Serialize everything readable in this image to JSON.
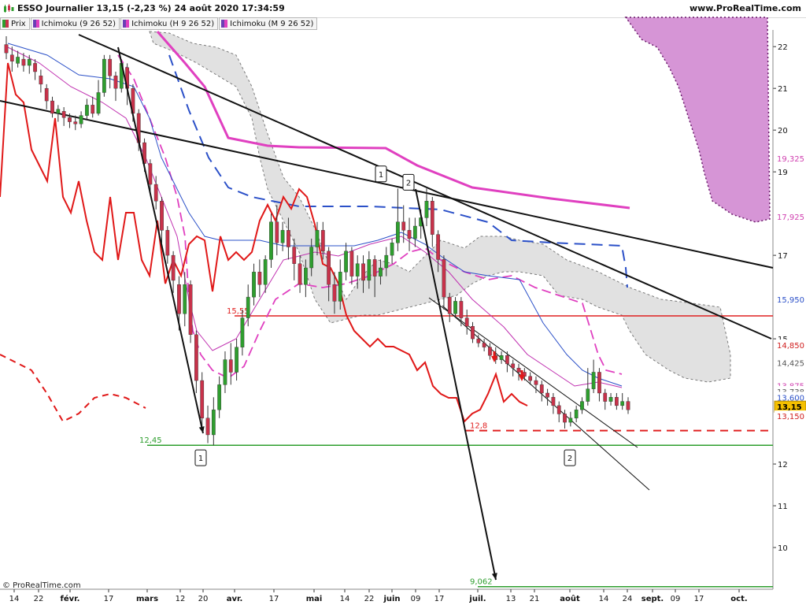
{
  "header": {
    "title": "ESSO Journalier 13,15 (-2,23 %) 24 août 2020 17:34:59",
    "site": "www.ProRealTime.com",
    "copyright": "© ProRealTime.com"
  },
  "legend": [
    {
      "label": "Prix",
      "color": "#2e9e2e",
      "color2": "#c8324a"
    },
    {
      "label": "Ichimoku (9 26 52)",
      "color": "#6a3fb5",
      "color2": "#e040c0"
    },
    {
      "label": "Ichimoku (H 9 26 52)",
      "color": "#6a3fb5",
      "color2": "#e040c0"
    },
    {
      "label": "Ichimoku (M 9 26 52)",
      "color": "#6a3fb5",
      "color2": "#e040c0"
    }
  ],
  "chart_data": {
    "type": "candlestick",
    "ylim": [
      9.0,
      22.4
    ],
    "y_ticks": [
      "22",
      "21",
      "20",
      "19",
      "17",
      "15",
      "12",
      "11",
      "10"
    ],
    "y_tick_values": [
      22,
      21,
      20,
      19,
      17,
      15,
      12,
      11,
      10
    ],
    "price_labels": [
      {
        "text": "19,325",
        "value": 19.325,
        "color": "#d040b0"
      },
      {
        "text": "17,925",
        "value": 17.925,
        "color": "#d040b0"
      },
      {
        "text": "15,950",
        "value": 15.95,
        "color": "#2b50c8"
      },
      {
        "text": "14,850",
        "value": 14.85,
        "color": "#d02020"
      },
      {
        "text": "14,425",
        "value": 14.425,
        "color": "#555555"
      },
      {
        "text": "13,875",
        "value": 13.875,
        "color": "#d040b0"
      },
      {
        "text": "13,738",
        "value": 13.738,
        "color": "#555555"
      },
      {
        "text": "13,600",
        "value": 13.6,
        "color": "#2b50c8"
      },
      {
        "text": "13,15",
        "value": 13.375,
        "color": "#000000",
        "bg": "#f5c000"
      },
      {
        "text": "13,150",
        "value": 13.15,
        "color": "#d02020"
      }
    ],
    "x_labels": [
      "14",
      "22",
      "févr.",
      "17",
      "mars",
      "12",
      "20",
      "avr.",
      "17",
      "mai",
      "14",
      "22",
      "juin",
      "09",
      "17",
      "juil.",
      "13",
      "21",
      "août",
      "14",
      "24",
      "sept.",
      "09",
      "17",
      "oct."
    ],
    "x_label_positions": [
      18,
      49,
      89,
      138,
      187,
      229,
      258,
      298,
      348,
      399,
      438,
      469,
      498,
      528,
      558,
      607,
      649,
      679,
      724,
      767,
      797,
      829,
      858,
      888,
      939
    ],
    "levels": [
      {
        "label": "15,55",
        "value": 15.55,
        "color": "#e02020",
        "style": "solid",
        "from_date": "avr."
      },
      {
        "label": "12,8",
        "value": 12.8,
        "color": "#e02020",
        "style": "dashed",
        "from_date": "juil."
      },
      {
        "label": "12,45",
        "value": 12.45,
        "color": "#2e9e2e",
        "style": "solid",
        "from_date": "mars"
      },
      {
        "label": "9,062",
        "value": 9.062,
        "color": "#2e9e2e",
        "style": "solid",
        "from_date": "juil."
      }
    ],
    "markers": [
      {
        "text": "1",
        "value": 18.95,
        "date": "juin"
      },
      {
        "text": "2",
        "value": 18.75,
        "date": "juin"
      },
      {
        "text": "1",
        "value": 12.15,
        "date": "mars"
      },
      {
        "text": "2",
        "value": 12.15,
        "date": "août"
      }
    ],
    "candles": [
      {
        "o": 22.05,
        "c": 21.85,
        "h": 22.25,
        "l": 21.7
      },
      {
        "o": 21.8,
        "c": 21.65,
        "h": 22.0,
        "l": 21.4
      },
      {
        "o": 21.6,
        "c": 21.75,
        "h": 21.9,
        "l": 21.5
      },
      {
        "o": 21.7,
        "c": 21.55,
        "h": 21.85,
        "l": 21.4
      },
      {
        "o": 21.55,
        "c": 21.7,
        "h": 21.8,
        "l": 21.35
      },
      {
        "o": 21.6,
        "c": 21.4,
        "h": 21.7,
        "l": 21.2
      },
      {
        "o": 21.3,
        "c": 21.1,
        "h": 21.45,
        "l": 20.9
      },
      {
        "o": 21.0,
        "c": 20.7,
        "h": 21.1,
        "l": 20.5
      },
      {
        "o": 20.7,
        "c": 20.4,
        "h": 20.8,
        "l": 20.3
      },
      {
        "o": 20.4,
        "c": 20.5,
        "h": 20.6,
        "l": 20.2
      },
      {
        "o": 20.45,
        "c": 20.3,
        "h": 20.55,
        "l": 20.1
      },
      {
        "o": 20.3,
        "c": 20.2,
        "h": 20.4,
        "l": 20.05
      },
      {
        "o": 20.2,
        "c": 20.15,
        "h": 20.35,
        "l": 20.0
      },
      {
        "o": 20.15,
        "c": 20.35,
        "h": 20.45,
        "l": 20.05
      },
      {
        "o": 20.35,
        "c": 20.6,
        "h": 20.75,
        "l": 20.25
      },
      {
        "o": 20.6,
        "c": 20.4,
        "h": 20.8,
        "l": 20.3
      },
      {
        "o": 20.4,
        "c": 20.9,
        "h": 21.2,
        "l": 20.35
      },
      {
        "o": 20.9,
        "c": 21.7,
        "h": 21.8,
        "l": 20.8
      },
      {
        "o": 21.7,
        "c": 21.3,
        "h": 21.8,
        "l": 21.0
      },
      {
        "o": 21.3,
        "c": 21.0,
        "h": 21.4,
        "l": 20.7
      },
      {
        "o": 21.0,
        "c": 21.6,
        "h": 21.7,
        "l": 20.9
      },
      {
        "o": 21.5,
        "c": 21.0,
        "h": 21.6,
        "l": 20.6
      },
      {
        "o": 21.0,
        "c": 20.4,
        "h": 21.1,
        "l": 20.2
      },
      {
        "o": 20.4,
        "c": 19.7,
        "h": 20.5,
        "l": 19.5
      },
      {
        "o": 19.7,
        "c": 19.2,
        "h": 19.8,
        "l": 19.0
      },
      {
        "o": 19.2,
        "c": 18.7,
        "h": 19.3,
        "l": 18.5
      },
      {
        "o": 18.7,
        "c": 18.3,
        "h": 18.9,
        "l": 18.1
      },
      {
        "o": 18.3,
        "c": 17.6,
        "h": 18.4,
        "l": 17.3
      },
      {
        "o": 17.6,
        "c": 17.0,
        "h": 17.7,
        "l": 16.8
      },
      {
        "o": 17.0,
        "c": 16.4,
        "h": 17.1,
        "l": 16.1
      },
      {
        "o": 16.3,
        "c": 15.6,
        "h": 16.5,
        "l": 15.2
      },
      {
        "o": 15.6,
        "c": 16.3,
        "h": 16.6,
        "l": 15.3
      },
      {
        "o": 16.3,
        "c": 15.1,
        "h": 16.4,
        "l": 14.9
      },
      {
        "o": 15.1,
        "c": 14.0,
        "h": 15.2,
        "l": 13.7
      },
      {
        "o": 14.0,
        "c": 13.1,
        "h": 14.2,
        "l": 12.9
      },
      {
        "o": 13.1,
        "c": 12.7,
        "h": 13.4,
        "l": 12.5
      },
      {
        "o": 12.7,
        "c": 13.3,
        "h": 13.6,
        "l": 12.45
      },
      {
        "o": 13.3,
        "c": 13.9,
        "h": 14.1,
        "l": 13.1
      },
      {
        "o": 13.9,
        "c": 14.5,
        "h": 14.7,
        "l": 13.7
      },
      {
        "o": 14.5,
        "c": 14.2,
        "h": 14.9,
        "l": 13.9
      },
      {
        "o": 14.2,
        "c": 14.8,
        "h": 15.0,
        "l": 14.0
      },
      {
        "o": 14.8,
        "c": 15.5,
        "h": 15.7,
        "l": 14.6
      },
      {
        "o": 15.5,
        "c": 16.0,
        "h": 16.3,
        "l": 15.3
      },
      {
        "o": 16.0,
        "c": 16.6,
        "h": 16.8,
        "l": 15.8
      },
      {
        "o": 16.6,
        "c": 16.3,
        "h": 16.9,
        "l": 16.0
      },
      {
        "o": 16.3,
        "c": 16.9,
        "h": 17.0,
        "l": 16.1
      },
      {
        "o": 16.9,
        "c": 17.8,
        "h": 18.0,
        "l": 16.7
      },
      {
        "o": 17.8,
        "c": 17.3,
        "h": 18.2,
        "l": 17.0
      },
      {
        "o": 17.3,
        "c": 17.6,
        "h": 17.8,
        "l": 17.1
      },
      {
        "o": 17.6,
        "c": 17.2,
        "h": 17.9,
        "l": 16.9
      },
      {
        "o": 17.2,
        "c": 16.8,
        "h": 17.4,
        "l": 16.4
      },
      {
        "o": 16.8,
        "c": 16.3,
        "h": 17.0,
        "l": 16.1
      },
      {
        "o": 16.3,
        "c": 16.7,
        "h": 16.9,
        "l": 16.0
      },
      {
        "o": 16.7,
        "c": 17.2,
        "h": 17.4,
        "l": 16.5
      },
      {
        "o": 17.2,
        "c": 17.6,
        "h": 17.8,
        "l": 17.0
      },
      {
        "o": 17.6,
        "c": 17.1,
        "h": 17.8,
        "l": 16.9
      },
      {
        "o": 17.1,
        "c": 16.3,
        "h": 17.2,
        "l": 15.9
      },
      {
        "o": 16.3,
        "c": 15.9,
        "h": 16.6,
        "l": 15.6
      },
      {
        "o": 15.9,
        "c": 16.6,
        "h": 16.9,
        "l": 15.7
      },
      {
        "o": 16.6,
        "c": 17.1,
        "h": 17.3,
        "l": 16.4
      },
      {
        "o": 17.1,
        "c": 16.5,
        "h": 17.2,
        "l": 16.3
      },
      {
        "o": 16.5,
        "c": 16.8,
        "h": 17.0,
        "l": 16.2
      },
      {
        "o": 16.8,
        "c": 16.4,
        "h": 17.0,
        "l": 16.1
      },
      {
        "o": 16.4,
        "c": 16.9,
        "h": 17.1,
        "l": 16.2
      },
      {
        "o": 16.9,
        "c": 16.5,
        "h": 17.0,
        "l": 16.0
      },
      {
        "o": 16.5,
        "c": 16.7,
        "h": 16.9,
        "l": 16.3
      },
      {
        "o": 16.7,
        "c": 17.0,
        "h": 17.2,
        "l": 16.5
      },
      {
        "o": 17.0,
        "c": 17.3,
        "h": 17.4,
        "l": 16.8
      },
      {
        "o": 17.3,
        "c": 17.8,
        "h": 18.6,
        "l": 17.1
      },
      {
        "o": 17.8,
        "c": 17.6,
        "h": 18.2,
        "l": 17.3
      },
      {
        "o": 17.6,
        "c": 17.4,
        "h": 17.9,
        "l": 17.1
      },
      {
        "o": 17.4,
        "c": 17.7,
        "h": 17.9,
        "l": 17.2
      },
      {
        "o": 17.7,
        "c": 17.9,
        "h": 18.1,
        "l": 17.4
      },
      {
        "o": 17.9,
        "c": 18.3,
        "h": 18.6,
        "l": 17.7
      },
      {
        "o": 18.3,
        "c": 17.5,
        "h": 18.4,
        "l": 17.2
      },
      {
        "o": 17.5,
        "c": 16.9,
        "h": 17.6,
        "l": 16.6
      },
      {
        "o": 16.9,
        "c": 16.0,
        "h": 17.0,
        "l": 15.7
      },
      {
        "o": 16.0,
        "c": 15.6,
        "h": 16.1,
        "l": 15.4
      },
      {
        "o": 15.6,
        "c": 15.9,
        "h": 16.0,
        "l": 15.5
      },
      {
        "o": 15.9,
        "c": 15.5,
        "h": 16.0,
        "l": 15.3
      },
      {
        "o": 15.5,
        "c": 15.3,
        "h": 15.7,
        "l": 15.1
      },
      {
        "o": 15.3,
        "c": 15.0,
        "h": 15.4,
        "l": 14.9
      },
      {
        "o": 15.0,
        "c": 14.9,
        "h": 15.1,
        "l": 14.8
      },
      {
        "o": 14.9,
        "c": 14.8,
        "h": 15.0,
        "l": 14.7
      },
      {
        "o": 14.8,
        "c": 14.6,
        "h": 14.9,
        "l": 14.5
      },
      {
        "o": 14.6,
        "c": 14.5,
        "h": 14.8,
        "l": 14.4
      },
      {
        "o": 14.5,
        "c": 14.6,
        "h": 14.7,
        "l": 14.4
      },
      {
        "o": 14.6,
        "c": 14.4,
        "h": 14.7,
        "l": 14.2
      },
      {
        "o": 14.4,
        "c": 14.3,
        "h": 14.5,
        "l": 14.1
      },
      {
        "o": 14.3,
        "c": 14.2,
        "h": 14.4,
        "l": 14.0
      },
      {
        "o": 14.2,
        "c": 14.1,
        "h": 14.3,
        "l": 14.0
      },
      {
        "o": 14.1,
        "c": 14.0,
        "h": 14.2,
        "l": 13.9
      },
      {
        "o": 14.0,
        "c": 13.9,
        "h": 14.1,
        "l": 13.7
      },
      {
        "o": 13.9,
        "c": 13.7,
        "h": 14.0,
        "l": 13.5
      },
      {
        "o": 13.7,
        "c": 13.6,
        "h": 13.8,
        "l": 13.4
      },
      {
        "o": 13.6,
        "c": 13.4,
        "h": 13.7,
        "l": 13.2
      },
      {
        "o": 13.4,
        "c": 13.2,
        "h": 13.5,
        "l": 13.0
      },
      {
        "o": 13.2,
        "c": 13.0,
        "h": 13.3,
        "l": 12.85
      },
      {
        "o": 13.0,
        "c": 13.1,
        "h": 13.25,
        "l": 12.9
      },
      {
        "o": 13.1,
        "c": 13.3,
        "h": 13.4,
        "l": 13.0
      },
      {
        "o": 13.3,
        "c": 13.5,
        "h": 13.6,
        "l": 13.2
      },
      {
        "o": 13.5,
        "c": 13.8,
        "h": 14.3,
        "l": 13.4
      },
      {
        "o": 13.8,
        "c": 14.2,
        "h": 14.5,
        "l": 13.7
      },
      {
        "o": 14.2,
        "c": 13.7,
        "h": 14.3,
        "l": 13.5
      },
      {
        "o": 13.7,
        "c": 13.5,
        "h": 13.8,
        "l": 13.3
      },
      {
        "o": 13.5,
        "c": 13.6,
        "h": 13.7,
        "l": 13.4
      },
      {
        "o": 13.6,
        "c": 13.4,
        "h": 13.7,
        "l": 13.3
      },
      {
        "o": 13.4,
        "c": 13.5,
        "h": 13.7,
        "l": 13.3
      },
      {
        "o": 13.5,
        "c": 13.3,
        "h": 13.6,
        "l": 13.2
      }
    ]
  }
}
